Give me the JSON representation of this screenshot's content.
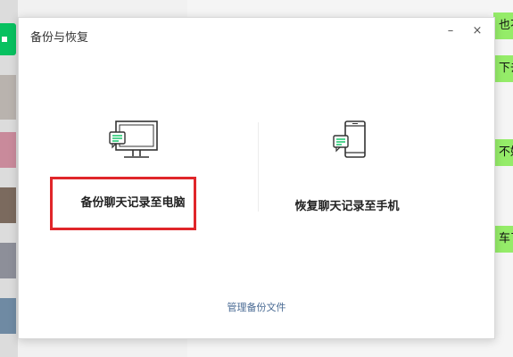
{
  "dialog": {
    "title": "备份与恢复",
    "minimize": "–",
    "close": "×"
  },
  "options": {
    "backup_label": "备份聊天记录至电脑",
    "restore_label": "恢复聊天记录至手机"
  },
  "manage_link": "管理备份文件",
  "background_chat": {
    "bubbles": [
      "也不",
      "下去",
      "不好",
      "车了"
    ]
  },
  "colors": {
    "accent_green": "#07c160",
    "highlight_red": "#e0262a",
    "link_blue": "#4a6b94"
  }
}
